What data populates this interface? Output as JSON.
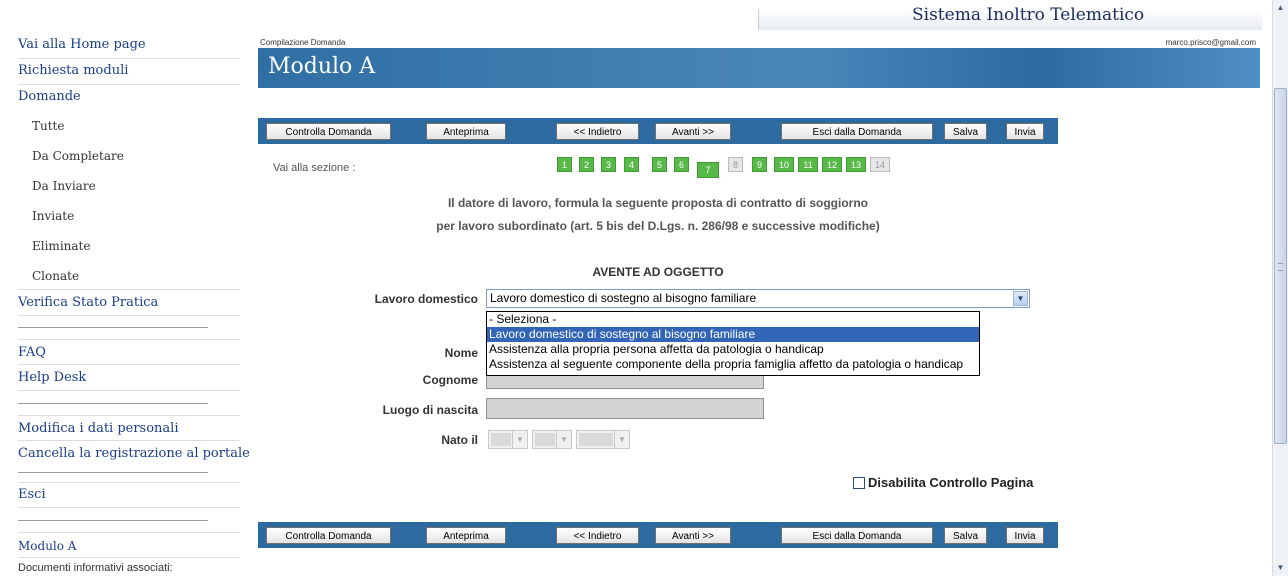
{
  "sidebar": {
    "home": "Vai alla Home page",
    "richiesta_moduli": "Richiesta moduli",
    "domande": "Domande",
    "domande_items": [
      "Tutte",
      "Da Completare",
      "Da Inviare",
      "Inviate",
      "Eliminate",
      "Clonate"
    ],
    "verifica": "Verifica Stato Pratica",
    "faq": "FAQ",
    "help_desk": "Help Desk",
    "modifica": "Modifica i dati personali",
    "cancella": "Cancella la registrazione al portale",
    "esci": "Esci",
    "modulo": "Modulo A",
    "documenti": "Documenti informativi associati:"
  },
  "header": {
    "system_title": "Sistema Inoltro Telematico",
    "breadcrumb": "Compilazione Domanda",
    "email": "marco.prisco@gmail.com",
    "page_title": "Modulo A"
  },
  "toolbar": {
    "controlla": "Controlla Domanda",
    "anteprima": "Anteprima",
    "indietro": "<< Indietro",
    "avanti": "Avanti >>",
    "esci_domanda": "Esci dalla Domanda",
    "salva": "Salva",
    "invia": "Invia"
  },
  "sections": {
    "label": "Vai alla sezione :",
    "numbers": [
      "1",
      "2",
      "3",
      "4",
      "5",
      "6",
      "7",
      "8",
      "9",
      "10",
      "11",
      "12",
      "13",
      "14"
    ],
    "current": "7"
  },
  "intro": {
    "line1": "Il datore di lavoro, formula la seguente proposta di contratto di soggiorno",
    "line2": "per lavoro subordinato (art. 5 bis del D.Lgs. n. 286/98 e successive modifiche)"
  },
  "form": {
    "section_title": "AVENTE AD OGGETTO",
    "lavoro_label": "Lavoro domestico",
    "lavoro_value": "Lavoro domestico di sostegno al bisogno familiare",
    "options": [
      "- Seleziona -",
      "Lavoro domestico di sostegno al bisogno familiare",
      "Assistenza alla propria persona affetta da patologia o handicap",
      "Assistenza al seguente componente della propria famiglia affetto da patologia o handicap"
    ],
    "nome_label": "Nome",
    "cognome_label": "Cognome",
    "luogo_label": "Luogo di nascita",
    "nato_label": "Nato il",
    "disabilita_label": "Disabilita Controllo Pagina"
  },
  "colors": {
    "accent": "#2d6aa0",
    "section_active": "#58b848",
    "selected_option": "#3264b7"
  }
}
